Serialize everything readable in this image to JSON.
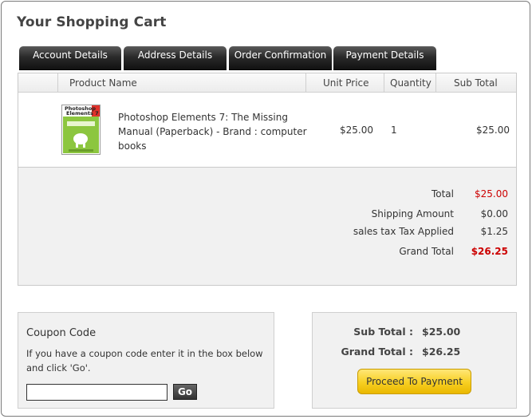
{
  "header": {
    "title": "Your Shopping Cart"
  },
  "tabs": [
    {
      "label": "Account Details"
    },
    {
      "label": "Address Details"
    },
    {
      "label": "Order Confirmation"
    },
    {
      "label": "Payment Details"
    }
  ],
  "table": {
    "columns": [
      "Product Name",
      "Unit Price",
      "Quantity",
      "Sub Total"
    ],
    "rows": [
      {
        "product_line1": "Photoshop Elements 7: The Missing",
        "product_line2": "Manual (Paperback) - Brand : computer",
        "product_line3": "books",
        "unit_price": "$25.00",
        "quantity": "1",
        "sub_total": "$25.00",
        "cover_title1": "Photoshop",
        "cover_title2": "Elements 7"
      }
    ]
  },
  "totals": {
    "total_label": "Total",
    "total_value": "$25.00",
    "shipping_label": "Shipping Amount",
    "shipping_value": "$0.00",
    "tax_label": "sales tax Tax Applied",
    "tax_value": "$1.25",
    "grand_label": "Grand Total",
    "grand_value": "$26.25"
  },
  "coupon": {
    "title": "Coupon Code",
    "line1": "If you have a coupon code enter it in the box below",
    "line2": "and click 'Go'.",
    "input_value": "",
    "go_label": "Go"
  },
  "summary": {
    "sub_total_label": "Sub Total :",
    "sub_total_value": "$25.00",
    "grand_total_label": "Grand Total :",
    "grand_total_value": "$26.25",
    "proceed_label": "Proceed To Payment"
  },
  "colors": {
    "highlight_red": "#cc0000",
    "tab_dark": "#1a1a1a",
    "button_yellow": "#f7cf22"
  }
}
